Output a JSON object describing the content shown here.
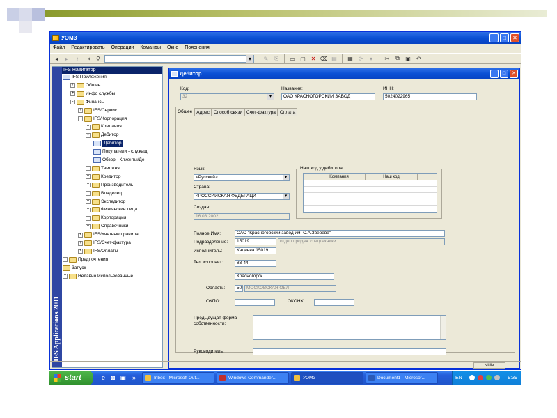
{
  "app": {
    "title": "УОМЗ",
    "menu": [
      "Файл",
      "Редактировать",
      "Операции",
      "Команды",
      "Окно",
      "Пояснения"
    ]
  },
  "navigator": {
    "title": "IFS Навигатор",
    "brand": "IFS Applications 2001",
    "root": "IFS Приложения",
    "nodes": [
      {
        "label": "Общие",
        "level": 1,
        "exp": "+",
        "icon": "folder"
      },
      {
        "label": "Инфо службы",
        "level": 1,
        "exp": "+",
        "icon": "folder"
      },
      {
        "label": "Финансы",
        "level": 1,
        "exp": "-",
        "icon": "folder"
      },
      {
        "label": "IFS/Сервис",
        "level": 2,
        "exp": "+",
        "icon": "folder"
      },
      {
        "label": "IFS/Корпорация",
        "level": 2,
        "exp": "-",
        "icon": "folder"
      },
      {
        "label": "Компания",
        "level": 3,
        "exp": "+",
        "icon": "folder"
      },
      {
        "label": "Дебитор",
        "level": 3,
        "exp": "-",
        "icon": "folder"
      },
      {
        "label": "Дебитор",
        "level": 4,
        "exp": "",
        "icon": "form",
        "selected": true
      },
      {
        "label": "Покупатели - служащ",
        "level": 4,
        "exp": "",
        "icon": "form"
      },
      {
        "label": "Обзор - Клиенты/Де",
        "level": 4,
        "exp": "",
        "icon": "form"
      },
      {
        "label": "Таможня",
        "level": 3,
        "exp": "+",
        "icon": "folder"
      },
      {
        "label": "Кредитор",
        "level": 3,
        "exp": "+",
        "icon": "folder"
      },
      {
        "label": "Производитель",
        "level": 3,
        "exp": "+",
        "icon": "folder"
      },
      {
        "label": "Владелец",
        "level": 3,
        "exp": "+",
        "icon": "folder"
      },
      {
        "label": "Экспедитор",
        "level": 3,
        "exp": "+",
        "icon": "folder"
      },
      {
        "label": "Физические лица",
        "level": 3,
        "exp": "+",
        "icon": "folder"
      },
      {
        "label": "Корпорация",
        "level": 3,
        "exp": "+",
        "icon": "folder"
      },
      {
        "label": "Справочники",
        "level": 3,
        "exp": "+",
        "icon": "folder"
      },
      {
        "label": "IFS/Учетные правила",
        "level": 2,
        "exp": "+",
        "icon": "folder"
      },
      {
        "label": "IFS/Счет-фактура",
        "level": 2,
        "exp": "+",
        "icon": "folder"
      },
      {
        "label": "IFS/Оплаты",
        "level": 2,
        "exp": "+",
        "icon": "folder"
      },
      {
        "label": "Предпочтения",
        "level": 0,
        "exp": "+",
        "icon": "folder"
      },
      {
        "label": "Запуск",
        "level": 0,
        "exp": "",
        "icon": "folder"
      },
      {
        "label": "Недавно Использованные",
        "level": 0,
        "exp": "+",
        "icon": "folder"
      }
    ]
  },
  "debtor": {
    "title": "Дебитор",
    "labels": {
      "code": "Код:",
      "name": "Название:",
      "inn": "ИНН:",
      "language": "Язык:",
      "country": "Страна:",
      "created": "Создан:",
      "our_code_group": "Наш код у дебитора",
      "full_name": "Полное Имя:",
      "division": "Подразделение:",
      "executor": "Исполнитель:",
      "phone": "Тел.исполнит:",
      "region": "Область:",
      "okpo": "ОКПО:",
      "okonh": "ОКОНХ:",
      "prev_form": "Предыдущая форма собственности:",
      "head": "Руководитель:"
    },
    "values": {
      "code": "32",
      "name": "ОАО КРАСНОГОРСКИЙ ЗАВОД",
      "inn": "5024022965",
      "language": "<Русский>",
      "country": "<РОССИЙСКАЯ ФЕДЕРАЦИ",
      "created": "16.08.2002",
      "full_name": "ОАО \"Красногорский завод им. С.А.Зверева\"",
      "division": "15019",
      "division_desc": "отдел продаж спецтехники",
      "executor": "Кадеева 15019",
      "phone": "83-44",
      "city": "Красногорск",
      "region_code": "50",
      "region_name": "МОСКОВСКАЯ ОБЛ",
      "okpo": "",
      "okonh": "",
      "prev_form": "",
      "head": ""
    },
    "tabs": [
      "Общее",
      "Адрес",
      "Способ связи",
      "Счет-фактура",
      "Оплата"
    ],
    "active_tab": "Общее",
    "grid_columns": [
      "Компания",
      "Наш код"
    ]
  },
  "status": {
    "num": "NUM"
  },
  "taskbar": {
    "start": "start",
    "tasks": [
      {
        "label": "Inbox - Microsoft Out...",
        "color": "#f0c040"
      },
      {
        "label": "Windows Commander...",
        "color": "#c03030"
      },
      {
        "label": "УОМЗ",
        "color": "#f0c040",
        "active": true
      },
      {
        "label": "Document1 - Microsof...",
        "color": "#2a5ab8"
      }
    ],
    "lang": "EN",
    "clock": "9:39"
  }
}
